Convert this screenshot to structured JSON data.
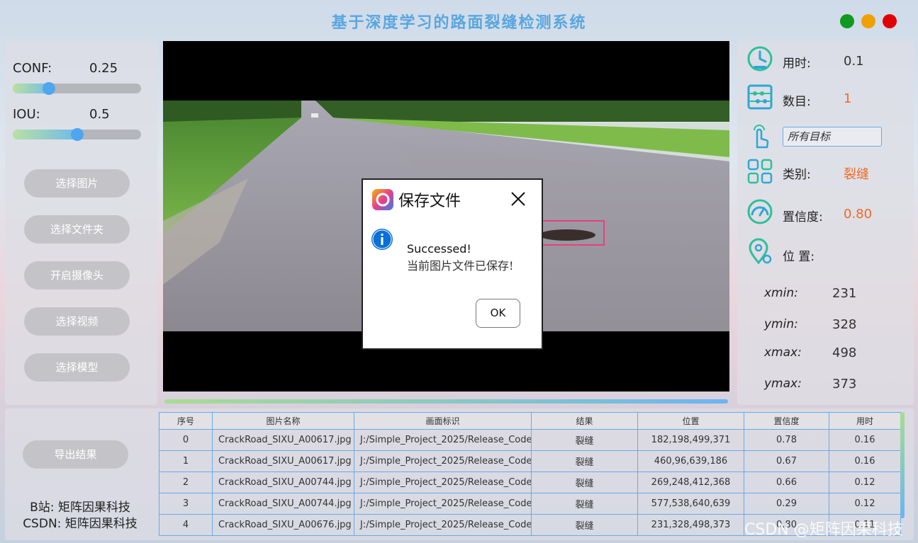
{
  "app": {
    "title": "基于深度学习的路面裂缝检测系统",
    "window_buttons": {
      "green": "#109a20",
      "yellow": "#f0a000",
      "red": "#e00000"
    }
  },
  "controls": {
    "conf_label": "CONF:",
    "conf_value": "0.25",
    "conf_fraction": 0.25,
    "iou_label": "IOU:",
    "iou_value": "0.5",
    "iou_fraction": 0.5,
    "buttons": [
      "选择图片",
      "选择文件夹",
      "开启摄像头",
      "选择视频",
      "选择模型"
    ],
    "export_label": "导出结果"
  },
  "credits": {
    "bilibili": "B站: 矩阵因果科技",
    "csdn": "CSDN: 矩阵因果科技"
  },
  "dialog": {
    "title": "保存文件",
    "message_line1": "Successed!",
    "message_line2": "当前图片文件已保存!",
    "ok_label": "OK"
  },
  "results": {
    "time_label": "用时:",
    "time_value": "0.1",
    "count_label": "数目:",
    "count_value": "1",
    "target_select": "所有目标",
    "class_label": "类别:",
    "class_value": "裂缝",
    "conf_label": "置信度:",
    "conf_value": "0.80",
    "pos_label": "位 置:",
    "xmin_label": "xmin:",
    "xmin": "231",
    "ymin_label": "ymin:",
    "ymin": "328",
    "xmax_label": "xmax:",
    "xmax": "498",
    "ymax_label": "ymax:",
    "ymax": "373",
    "accent_color": "#f26722"
  },
  "table": {
    "headers": [
      "序号",
      "图片名称",
      "画面标识",
      "结果",
      "位置",
      "置信度",
      "用时"
    ],
    "rows": [
      [
        "0",
        "CrackRoad_SIXU_A00617.jpg",
        "J:/Simple_Project_2025/Release_Code...",
        "裂缝",
        "182,198,499,371",
        "0.78",
        "0.16"
      ],
      [
        "1",
        "CrackRoad_SIXU_A00617.jpg",
        "J:/Simple_Project_2025/Release_Code...",
        "裂缝",
        "460,96,639,186",
        "0.67",
        "0.16"
      ],
      [
        "2",
        "CrackRoad_SIXU_A00744.jpg",
        "J:/Simple_Project_2025/Release_Code...",
        "裂缝",
        "269,248,412,368",
        "0.66",
        "0.12"
      ],
      [
        "3",
        "CrackRoad_SIXU_A00744.jpg",
        "J:/Simple_Project_2025/Release_Code...",
        "裂缝",
        "577,538,640,639",
        "0.29",
        "0.12"
      ],
      [
        "4",
        "CrackRoad_SIXU_A00676.jpg",
        "J:/Simple_Project_2025/Release_Code...",
        "裂缝",
        "231,328,498,373",
        "0.80",
        "0.11"
      ]
    ]
  },
  "watermark": "CSDN @矩阵因果科技"
}
